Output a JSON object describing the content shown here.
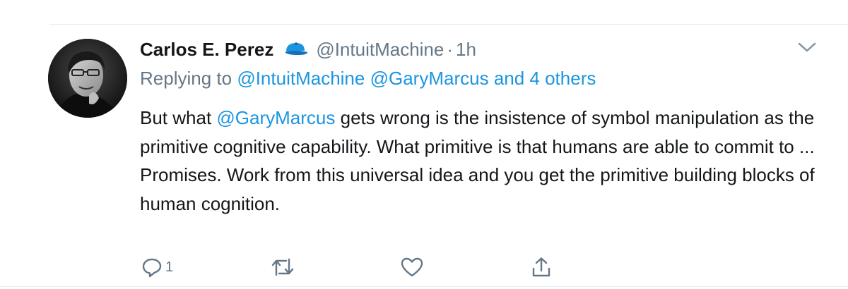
{
  "tweet": {
    "author_name": "Carlos E. Perez",
    "author_handle": "@IntuitMachine",
    "separator": "·",
    "time": "1h",
    "replying_prefix": "Replying to ",
    "replying_mentions": [
      "@IntuitMachine",
      "@GaryMarcus"
    ],
    "replying_others": "and 4 others",
    "text_before_mention": "But what ",
    "text_mention": "@GaryMarcus",
    "text_after_mention": " gets wrong is the insistence of symbol manipulation as the primitive cognitive capability.  What primitive is that humans are able to commit to ... Promises.  Work from this universal idea and you get the primitive building blocks of human cognition."
  },
  "actions": {
    "reply_count": "1",
    "retweet_count": "",
    "like_count": ""
  },
  "icons": {
    "avatar": "avatar-photo",
    "badge": "blue-cap-icon",
    "caret": "chevron-down-icon",
    "reply": "reply-icon",
    "retweet": "retweet-icon",
    "like": "heart-icon",
    "share": "share-icon"
  },
  "colors": {
    "text": "#14171a",
    "muted": "#657786",
    "link": "#1b95e0",
    "divider": "#e6ecf0"
  }
}
